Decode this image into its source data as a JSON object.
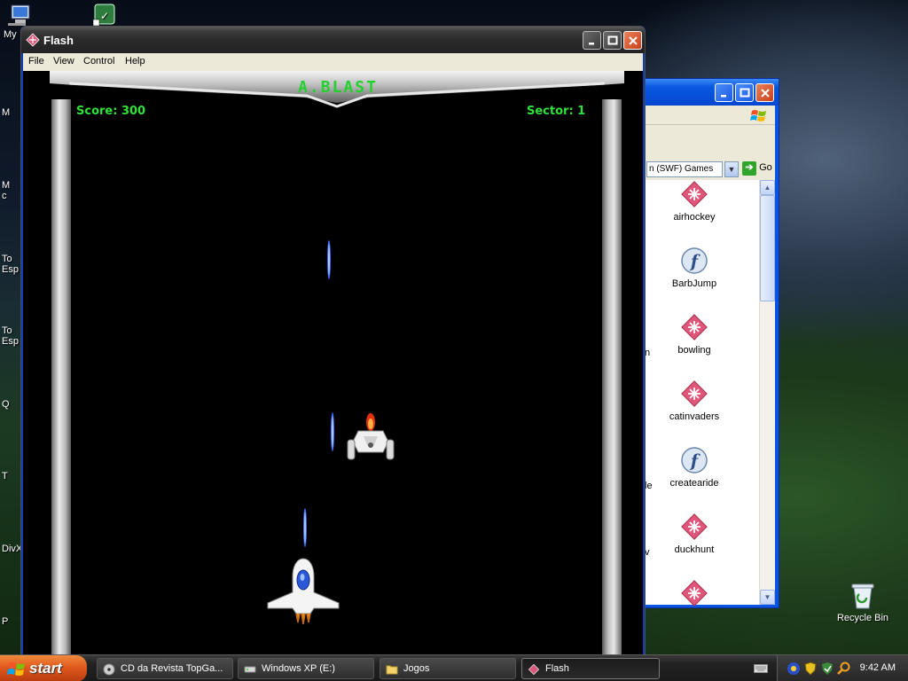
{
  "desktop": {
    "icons": [
      {
        "label": "My",
        "icon": "my-computer-icon"
      },
      {
        "label": "",
        "icon": "shortcut-icon"
      },
      {
        "label": "Recycle Bin",
        "icon": "recycle-bin-icon"
      }
    ],
    "edge_labels": [
      "M",
      "M\nc",
      "To\nEsp",
      "To\nEsp",
      "Q",
      "T",
      "DivX",
      "P"
    ]
  },
  "explorer": {
    "address": "n (SWF) Games",
    "go_label": "Go",
    "files": [
      {
        "name": "airhockey",
        "icon": "swf-diamond-icon"
      },
      {
        "name": "BarbJump",
        "icon": "flash-f-icon"
      },
      {
        "name": "bowling",
        "icon": "swf-diamond-icon"
      },
      {
        "name": "catinvaders",
        "icon": "swf-diamond-icon"
      },
      {
        "name": "createaride",
        "icon": "flash-f-icon"
      },
      {
        "name": "duckhunt",
        "icon": "swf-diamond-icon"
      },
      {
        "name": "",
        "icon": "swf-diamond-icon"
      }
    ],
    "clipped_left_text": [
      "n",
      "le",
      "v"
    ]
  },
  "flash": {
    "title": "Flash",
    "menu": [
      "File",
      "View",
      "Control",
      "Help"
    ],
    "game": {
      "logo": "A.BLAST",
      "score_text": "Score: 300",
      "sector_text": "Sector: 1"
    }
  },
  "taskbar": {
    "start_label": "start",
    "tasks": [
      {
        "label": "CD da Revista TopGa...",
        "icon": "cd-icon",
        "active": false
      },
      {
        "label": "Windows XP (E:)",
        "icon": "drive-icon",
        "active": false
      },
      {
        "label": "Jogos",
        "icon": "folder-icon",
        "active": false
      },
      {
        "label": "Flash",
        "icon": "flash-app-icon",
        "active": true
      }
    ],
    "clock": "9:42 AM"
  },
  "colors": {
    "hud_green": "#2ee23a",
    "xp_blue": "#0a54e3",
    "start_orange": "#e0581d"
  }
}
